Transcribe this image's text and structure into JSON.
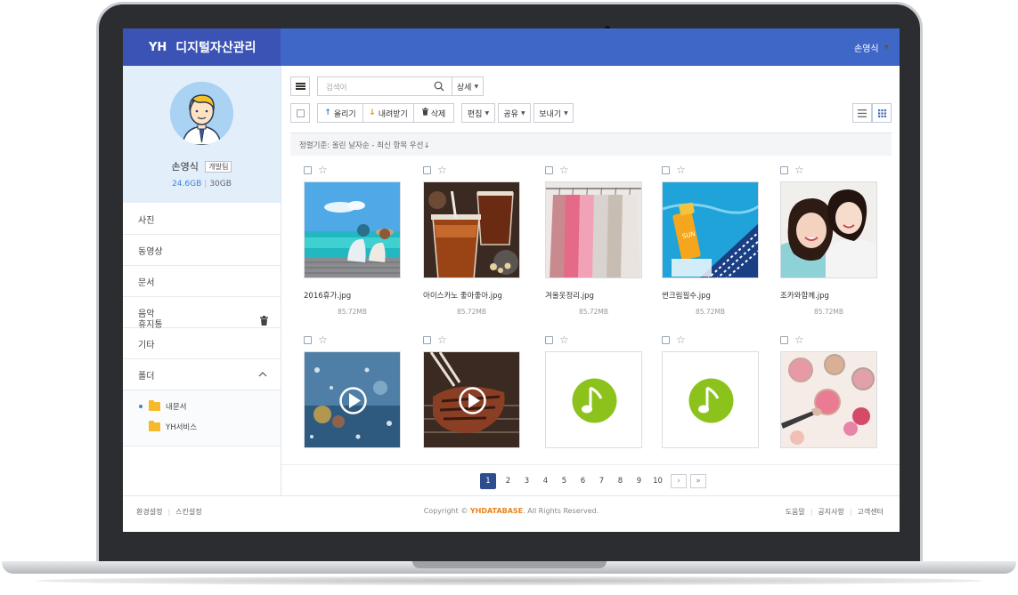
{
  "app": {
    "logo": "YH",
    "title": "디지털자산관리",
    "user": "손영식"
  },
  "profile": {
    "name": "손영식",
    "team": "개발팀",
    "used": "24.6GB",
    "total": "30GB"
  },
  "menu": [
    {
      "label": "사진"
    },
    {
      "label": "동영상"
    },
    {
      "label": "문서"
    },
    {
      "label": "음악"
    },
    {
      "label": "기타"
    },
    {
      "label": "폴더"
    }
  ],
  "folders": [
    {
      "label": "내문서"
    },
    {
      "label": "YH서비스"
    }
  ],
  "trash": "휴지통",
  "search": {
    "placeholder": "검색어",
    "detail": "상세"
  },
  "toolbar": {
    "upload": "올리기",
    "download": "내려받기",
    "delete": "삭제",
    "edit": "편집",
    "share": "공유",
    "send": "보내기"
  },
  "sort": "정렬기준: 올린 날자순 - 최신 항목 우선↓",
  "files": [
    {
      "name": "2016휴가.jpg",
      "size": "85.72MB",
      "kind": "beach"
    },
    {
      "name": "아이스카노 좋아좋아.jpg",
      "size": "85.72MB",
      "kind": "coffee"
    },
    {
      "name": "겨울옷정리.jpg",
      "size": "85.72MB",
      "kind": "clothes"
    },
    {
      "name": "썬크림필수.jpg",
      "size": "85.72MB",
      "kind": "sunscreen"
    },
    {
      "name": "조카와함께.jpg",
      "size": "85.72MB",
      "kind": "family"
    },
    {
      "kind": "rain-video"
    },
    {
      "kind": "meat-video"
    },
    {
      "kind": "music"
    },
    {
      "kind": "music"
    },
    {
      "kind": "makeup"
    }
  ],
  "pagination": [
    "1",
    "2",
    "3",
    "4",
    "5",
    "6",
    "7",
    "8",
    "9",
    "10"
  ],
  "footer": {
    "left": [
      "환경설정",
      "스킨설정"
    ],
    "copyright_pre": "Copyright ©",
    "company": "YHDATABASE",
    "copyright_post": ". All Rights Reserved.",
    "right": [
      "도움말",
      "공지사항",
      "고객센터"
    ]
  },
  "colors": {
    "header": "#3f67c8",
    "brand": "#3b53b4",
    "accent": "#3e82d6",
    "music": "#8cc21c"
  }
}
